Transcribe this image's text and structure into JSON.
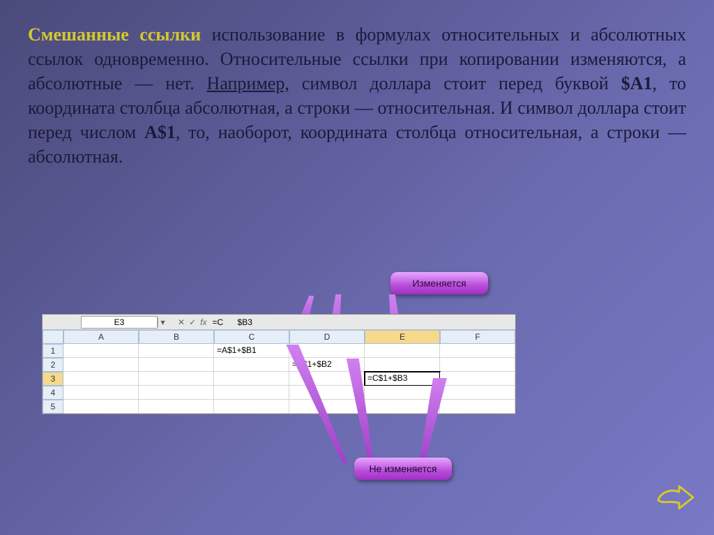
{
  "title_highlight": "Смешанные ссылки",
  "body_text_parts": {
    "p1": " использование в формулах относительных и абсолютных ссылок одновременно. Относительные ссылки при копировании изменяются, а абсолютные — нет. ",
    "example_word": "Например,",
    "p2": " символ доллара стоит перед буквой ",
    "ref1": "$А1",
    "p3": ", то координата столбца абсолютная, а строки — относительная. И символ доллара стоит перед числом ",
    "ref2": "А$1",
    "p4": ", то, наоборот, координата столбца относительная, а строки — абсолютная."
  },
  "callouts": {
    "top": "Изменяется",
    "bottom": "Не изменяется"
  },
  "excel": {
    "namebox": "E3",
    "formula_bar_partial_left": "=C",
    "formula_bar_partial_right": "$B3",
    "columns": [
      "A",
      "B",
      "C",
      "D",
      "E",
      "F"
    ],
    "rows": [
      "1",
      "2",
      "3",
      "4",
      "5"
    ],
    "cells": {
      "C1": "=A$1+$B1",
      "D2": "=B$1+$B2",
      "E3": "=C$1+$B3"
    },
    "selected": "E3"
  },
  "icons": {
    "fx_cancel": "✕",
    "fx_enter": "✓",
    "fx_label": "fx",
    "dropdown": "▾"
  }
}
